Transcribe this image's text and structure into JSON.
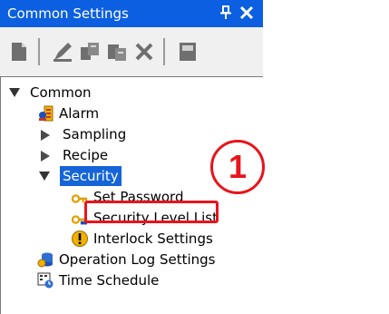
{
  "window": {
    "title": "Common Settings",
    "pin_glyph": "⨪",
    "close_glyph": "✕"
  },
  "toolbar": {
    "buttons": [
      {
        "icon": "new-document-icon"
      },
      {
        "icon": "edit-icon"
      },
      {
        "icon": "duplicate-icon"
      },
      {
        "icon": "copy-icon"
      },
      {
        "icon": "delete-icon"
      },
      {
        "icon": "properties-icon"
      }
    ]
  },
  "tree": {
    "root": "Common",
    "items": {
      "alarm": "Alarm",
      "sampling": "Sampling",
      "recipe": "Recipe",
      "security": "Security",
      "set_password": "Set Password",
      "security_level_list": "Security Level List",
      "interlock_settings": "Interlock Settings",
      "operation_log": "Operation Log Settings",
      "time_schedule": "Time Schedule"
    },
    "selected": "Security"
  },
  "annotation": {
    "step_number": "1",
    "color": "#e8141c"
  },
  "colors": {
    "titlebar": "#0b5fe0",
    "selection": "#1565d8"
  }
}
